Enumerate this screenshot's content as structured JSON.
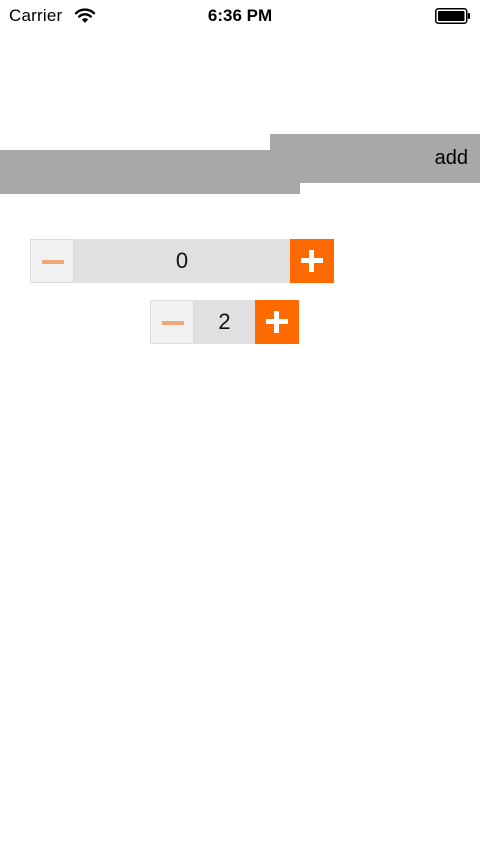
{
  "status_bar": {
    "carrier": "Carrier",
    "time": "6:36 PM",
    "wifi_icon": "wifi-icon",
    "battery_icon": "battery-icon"
  },
  "add_button": {
    "label": "add"
  },
  "steppers": [
    {
      "value": "0",
      "minus_icon": "minus-icon",
      "plus_icon": "plus-icon"
    },
    {
      "value": "2",
      "minus_icon": "minus-icon",
      "plus_icon": "plus-icon"
    }
  ],
  "colors": {
    "accent": "#ff6a00",
    "minus_glyph": "#f2a778",
    "grey_bar": "#a8a8a8",
    "field_bg": "#e0e0e0",
    "minus_bg": "#f1f1f1"
  }
}
